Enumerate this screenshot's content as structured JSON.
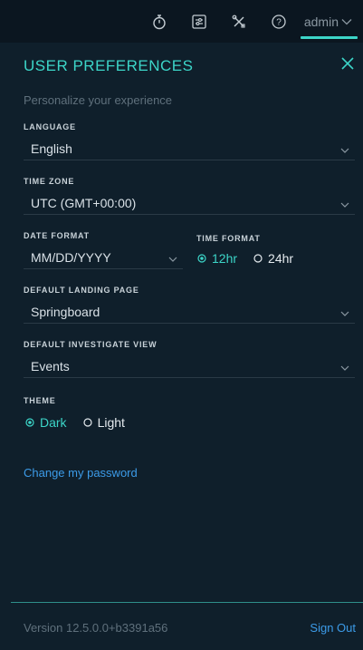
{
  "topbar": {
    "icons": [
      "stopwatch-icon",
      "sliders-icon",
      "tools-icon",
      "help-icon"
    ],
    "user": "admin"
  },
  "prefs": {
    "title": "USER PREFERENCES",
    "subtitle": "Personalize your experience",
    "language": {
      "label": "LANGUAGE",
      "value": "English"
    },
    "time_zone": {
      "label": "TIME ZONE",
      "value": "UTC (GMT+00:00)"
    },
    "date_format": {
      "label": "DATE FORMAT",
      "value": "MM/DD/YYYY"
    },
    "time_format": {
      "label": "TIME FORMAT",
      "options": [
        "12hr",
        "24hr"
      ],
      "selected": "12hr"
    },
    "landing_page": {
      "label": "DEFAULT LANDING PAGE",
      "value": "Springboard"
    },
    "investigate_view": {
      "label": "DEFAULT INVESTIGATE VIEW",
      "value": "Events"
    },
    "theme": {
      "label": "THEME",
      "options": [
        "Dark",
        "Light"
      ],
      "selected": "Dark"
    },
    "change_password": "Change my password"
  },
  "footer": {
    "version": "Version 12.5.0.0+b3391a56",
    "sign_out": "Sign Out"
  },
  "colors": {
    "accent": "#3cd5c8",
    "link": "#3c9be8",
    "background": "#0f1f2b",
    "topbar": "#0b1620"
  }
}
